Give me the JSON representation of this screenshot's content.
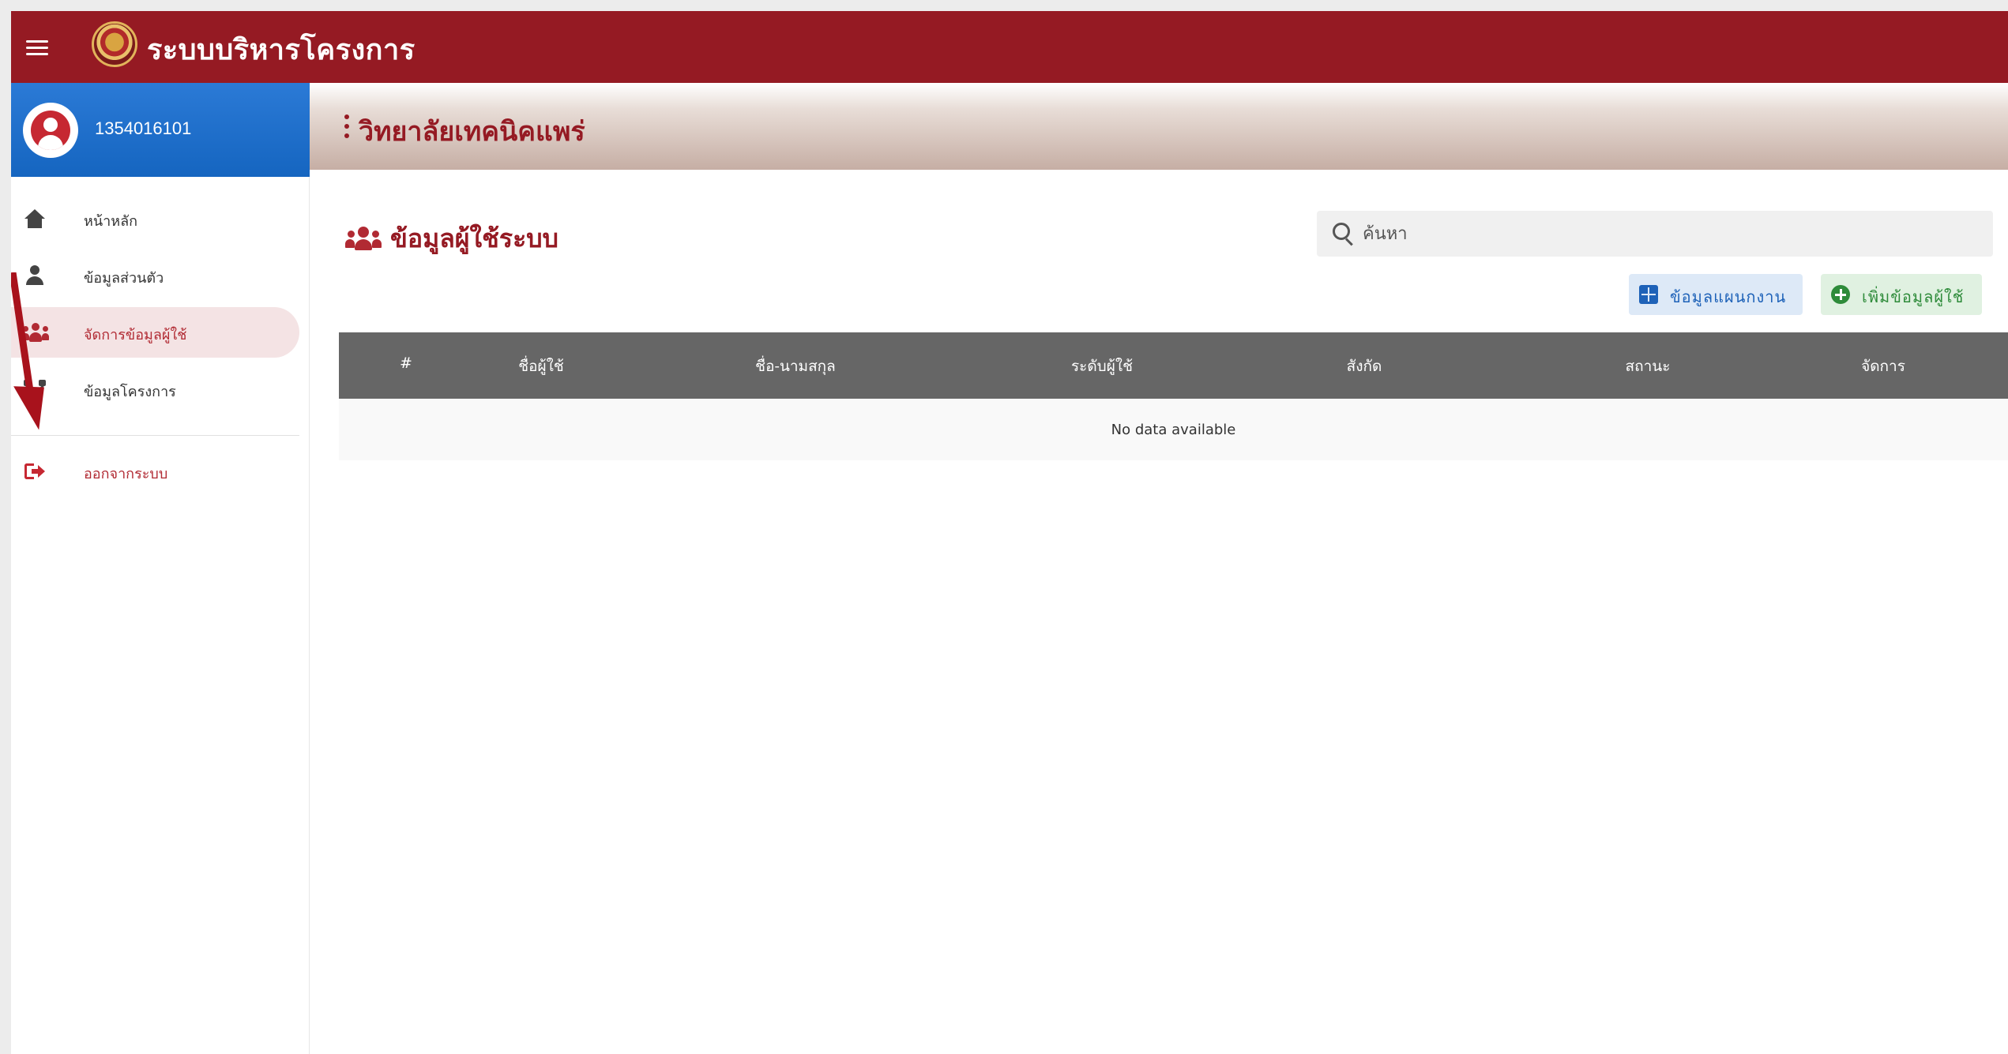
{
  "app": {
    "title": "ระบบบริหารโครงการ"
  },
  "user": {
    "id": "1354016101"
  },
  "sidebar": {
    "items": [
      {
        "label": "หน้าหลัก",
        "icon": "home-icon"
      },
      {
        "label": "ข้อมูลส่วนตัว",
        "icon": "user-icon"
      },
      {
        "label": "จัดการข้อมูลผู้ใช้",
        "icon": "users-icon",
        "active": true
      },
      {
        "label": "ข้อมูลโครงการ",
        "icon": "sitemap-icon"
      }
    ],
    "logout": {
      "label": "ออกจากระบบ",
      "icon": "logout-icon"
    }
  },
  "org": {
    "name": "วิทยาลัยเทคนิคแพร่"
  },
  "page": {
    "title": "ข้อมูลผู้ใช้ระบบ"
  },
  "search": {
    "placeholder": "ค้นหา",
    "value": ""
  },
  "buttons": {
    "plan_label": "ข้อมูลแผนกงาน",
    "add_label": "เพิ่มข้อมูลผู้ใช้"
  },
  "table": {
    "columns": [
      "#",
      "ชื่อผู้ใช้",
      "ชื่อ-นามสกุล",
      "ระดับผู้ใช้",
      "สังกัด",
      "สถานะ",
      "จัดการ"
    ],
    "rows": [],
    "empty_text": "No data available"
  },
  "colors": {
    "topbar": "#951a23",
    "user_card": "#1565c0",
    "accent": "#b12a33",
    "table_header": "#666666",
    "annotation_arrow": "#a8121c"
  }
}
